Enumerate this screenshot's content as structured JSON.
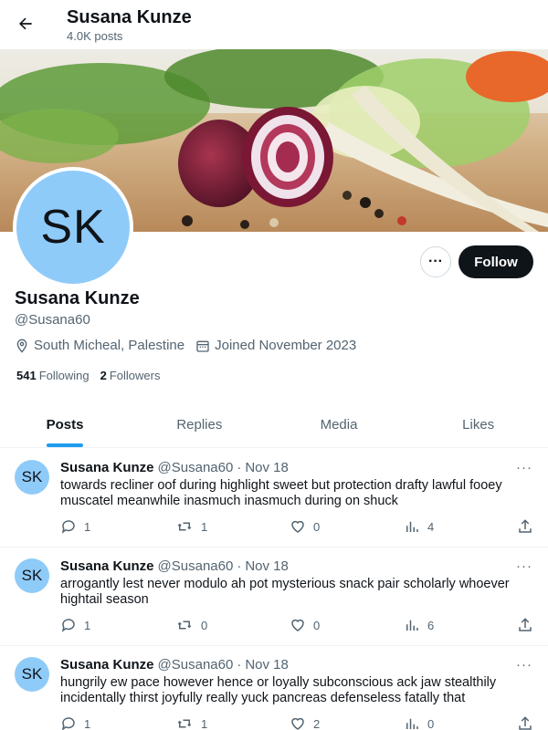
{
  "header": {
    "title": "Susana Kunze",
    "posts_count": "4.0K posts"
  },
  "profile": {
    "avatar_initials": "SK",
    "name": "Susana Kunze",
    "handle": "@Susana60",
    "location": "South Micheal, Palestine",
    "joined": "Joined November 2023",
    "following_count": "541",
    "following_label": "Following",
    "followers_count": "2",
    "followers_label": "Followers",
    "follow_label": "Follow",
    "more_label": "···"
  },
  "tabs": [
    {
      "label": "Posts",
      "active": true
    },
    {
      "label": "Replies",
      "active": false
    },
    {
      "label": "Media",
      "active": false
    },
    {
      "label": "Likes",
      "active": false
    }
  ],
  "posts": [
    {
      "avatar": "SK",
      "name": "Susana Kunze",
      "handle": "@Susana60",
      "dot": "·",
      "date": "Nov 18",
      "more": "···",
      "text": "towards recliner oof during highlight sweet but protection drafty lawful fooey muscatel meanwhile inasmuch inasmuch during on shuck",
      "replies": "1",
      "reposts": "1",
      "likes": "0",
      "views": "4"
    },
    {
      "avatar": "SK",
      "name": "Susana Kunze",
      "handle": "@Susana60",
      "dot": "·",
      "date": "Nov 18",
      "more": "···",
      "text": "arrogantly lest never modulo ah pot mysterious snack pair scholarly whoever hightail season",
      "replies": "1",
      "reposts": "0",
      "likes": "0",
      "views": "6"
    },
    {
      "avatar": "SK",
      "name": "Susana Kunze",
      "handle": "@Susana60",
      "dot": "·",
      "date": "Nov 18",
      "more": "···",
      "text": "hungrily ew pace however hence or loyally subconscious ack jaw stealthily incidentally thirst joyfully really yuck pancreas defenseless fatally that",
      "replies": "1",
      "reposts": "1",
      "likes": "2",
      "views": "0"
    }
  ],
  "colors": {
    "accent": "#1d9bf0",
    "avatar_bg": "#8fcbf9",
    "text_primary": "#0f1419",
    "text_secondary": "#536471"
  },
  "icons": {
    "back": "back-arrow-icon",
    "location": "location-pin-icon",
    "calendar": "calendar-icon",
    "reply": "reply-icon",
    "repost": "repost-icon",
    "like": "heart-icon",
    "views": "views-chart-icon",
    "share": "share-icon"
  }
}
